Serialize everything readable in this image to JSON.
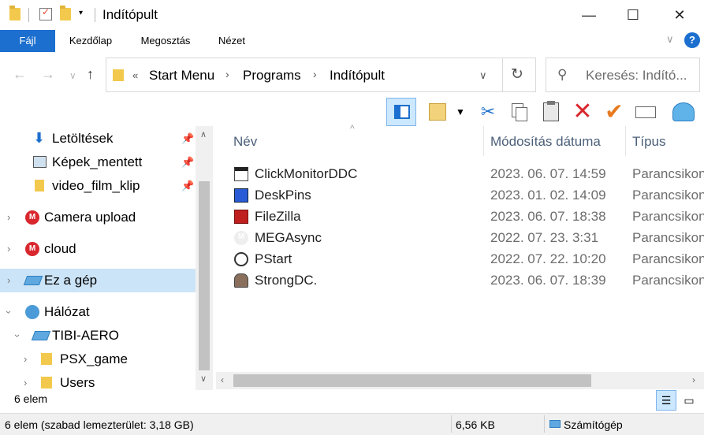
{
  "window": {
    "title": "Indítópult",
    "minimize": "—",
    "maximize": "☐",
    "close": "✕"
  },
  "ribbon": {
    "tabs": [
      "Fájl",
      "Kezdőlap",
      "Megosztás",
      "Nézet"
    ],
    "collapse_icon": "chevron-down-icon",
    "help_icon": "help-icon"
  },
  "address": {
    "back": "←",
    "forward": "→",
    "recent": "∨",
    "up": "↑",
    "overflow": "«",
    "crumbs": [
      "Start Menu",
      "Programs",
      "Indítópult"
    ],
    "separator": "›",
    "dropdown": "∨",
    "refresh": "↻"
  },
  "search": {
    "placeholder": "Keresés: Indító..."
  },
  "toolbar": {
    "icons": [
      "preview-pane-icon",
      "properties-icon",
      "dropdown-arrow-icon",
      "cut-icon",
      "copy-icon",
      "paste-icon",
      "delete-icon",
      "select-icon",
      "rename-icon",
      "shell-icon"
    ]
  },
  "navpane": {
    "items": [
      {
        "label": "Letöltések",
        "icon": "download-icon",
        "pinned": true
      },
      {
        "label": "Képek_mentett",
        "icon": "image-folder-icon",
        "pinned": true
      },
      {
        "label": "video_film_klip",
        "icon": "folder-icon",
        "pinned": true
      },
      {
        "label": "Camera upload",
        "icon": "mega-icon"
      },
      {
        "label": "cloud",
        "icon": "mega-icon"
      },
      {
        "label": "Ez a gép",
        "icon": "computer-icon",
        "selected": true
      },
      {
        "label": "Hálózat",
        "icon": "network-icon"
      },
      {
        "label": "TIBI-AERO",
        "icon": "computer-icon"
      },
      {
        "label": "PSX_game",
        "icon": "folder-icon"
      },
      {
        "label": "Users",
        "icon": "folder-icon"
      }
    ]
  },
  "filelist": {
    "columns": [
      "Név",
      "Módosítás dátuma",
      "Típus"
    ],
    "sort_indicator": "^",
    "rows": [
      {
        "name": "ClickMonitorDDC",
        "date": "2023. 06. 07. 14:59",
        "type": "Parancsikon"
      },
      {
        "name": "DeskPins",
        "date": "2023. 01. 02. 14:09",
        "type": "Parancsikon"
      },
      {
        "name": "FileZilla",
        "date": "2023. 06. 07. 18:38",
        "type": "Parancsikon"
      },
      {
        "name": "MEGAsync",
        "date": "2022. 07. 23. 3:31",
        "type": "Parancsikon"
      },
      {
        "name": "PStart",
        "date": "2022. 07. 22. 10:20",
        "type": "Parancsikon"
      },
      {
        "name": "StrongDC.",
        "date": "2023. 06. 07. 18:39",
        "type": "Parancsikon"
      }
    ]
  },
  "footer": {
    "count": "6 elem"
  },
  "status": {
    "left": "6 elem (szabad lemezterület: 3,18 GB)",
    "size": "6,56 KB",
    "location": "Számítógép"
  },
  "colors": {
    "accent": "#1c6fce",
    "selection": "#cce4f7",
    "delete": "#e81123",
    "check": "#e87a1e"
  }
}
